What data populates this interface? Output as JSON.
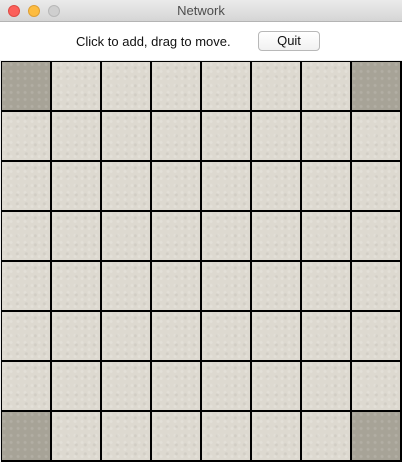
{
  "window": {
    "title": "Network"
  },
  "toolbar": {
    "instruction": "Click to add, drag to move.",
    "quit_label": "Quit"
  },
  "grid": {
    "rows": 8,
    "columns": 8,
    "corner_cells": [
      [
        0,
        0
      ],
      [
        0,
        7
      ],
      [
        7,
        0
      ],
      [
        7,
        7
      ]
    ]
  },
  "colors": {
    "cell": "#ddd9d0",
    "corner_cell": "#a7a397",
    "grid_line": "#000000"
  }
}
